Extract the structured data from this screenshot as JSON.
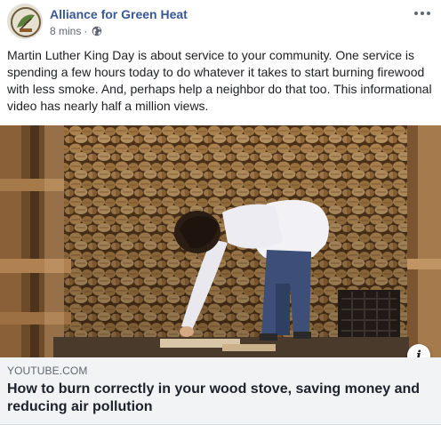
{
  "post": {
    "page_name": "Alliance for Green Heat",
    "timestamp": "8 mins",
    "separator": "·",
    "audience_icon": "globe-icon",
    "more_icon": "more-options-icon",
    "message": "Martin Luther King Day is about service to your community. One service is spending a few hours today to do whatever it takes to start burning firewood with less smoke. And, perhaps help a neighbor do that too. This informational video has nearly half a million views."
  },
  "link_preview": {
    "domain": "YOUTUBE.COM",
    "title": "How to burn correctly in your wood stove, saving money and reducing air pollution",
    "info_icon_label": "i"
  },
  "colors": {
    "link_blue": "#385898",
    "meta_gray": "#606770",
    "preview_bg": "#f2f3f5"
  }
}
